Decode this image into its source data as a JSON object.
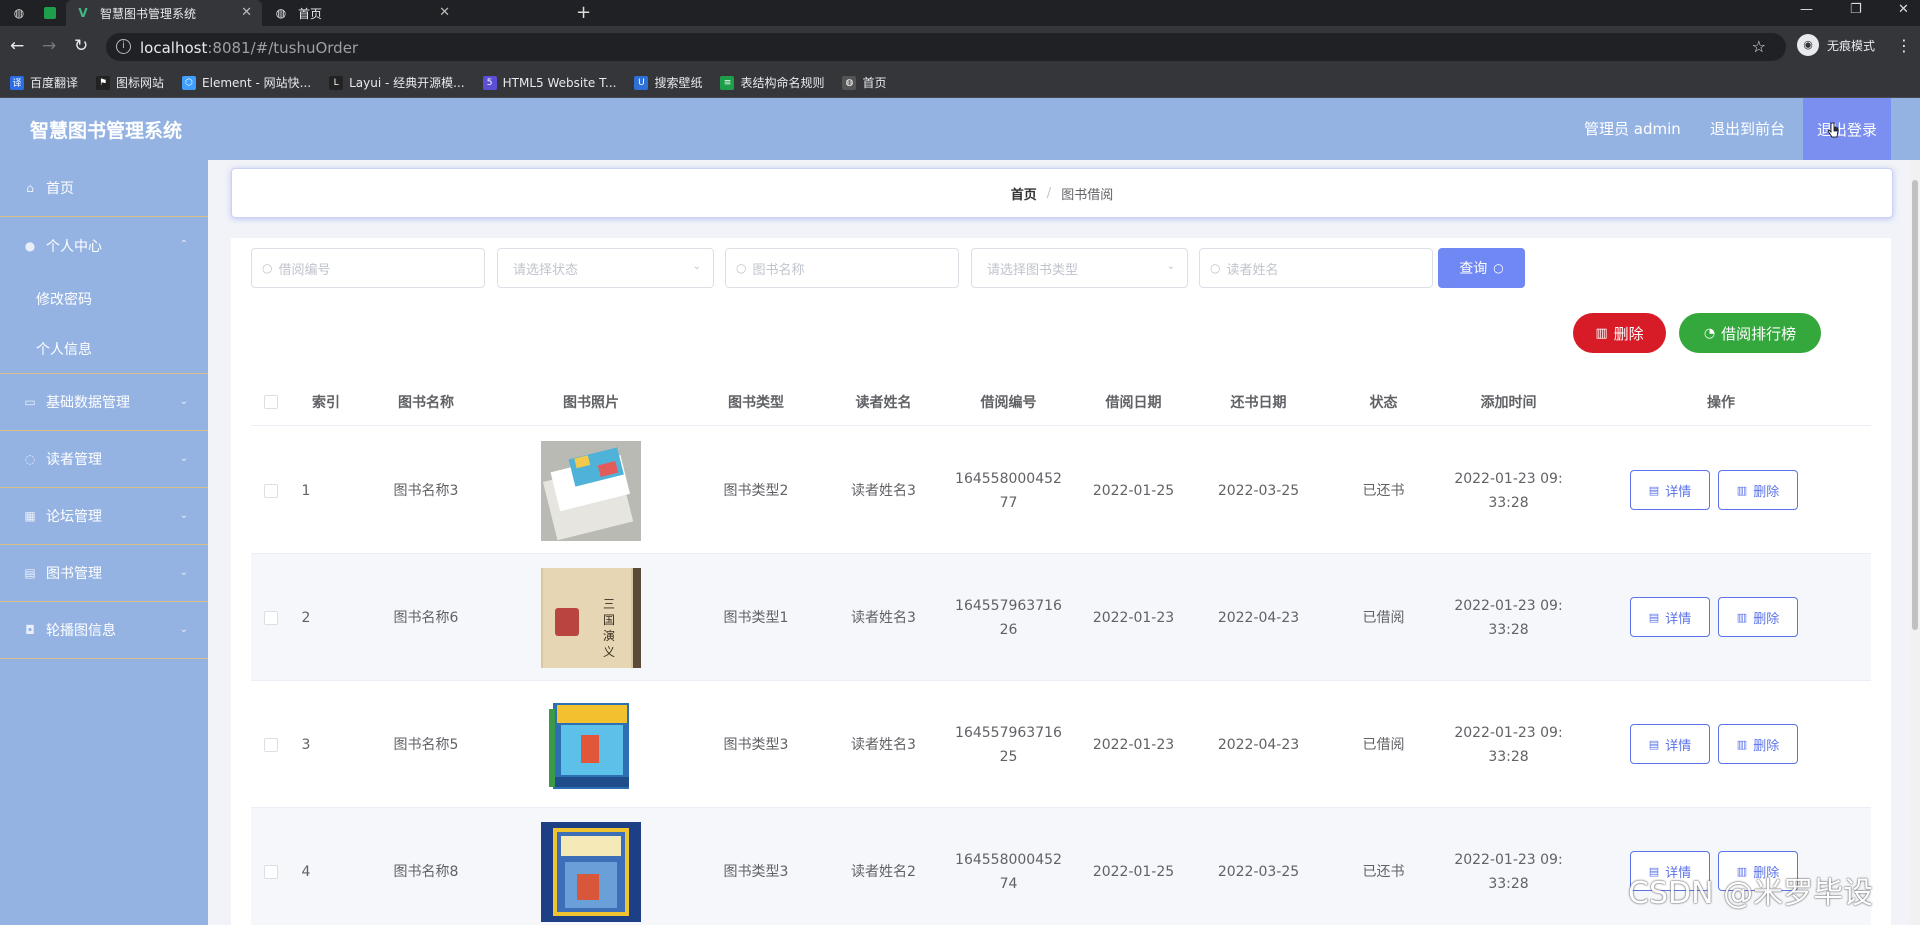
{
  "browser": {
    "tabs": [
      {
        "title": "智慧图书管理系统",
        "active": true
      },
      {
        "title": "首页",
        "active": false
      }
    ],
    "url_host": "localhost",
    "url_rest": ":8081/#/tushuOrder",
    "profile_label": "无痕模式",
    "bookmarks": [
      {
        "label": "百度翻译",
        "color": "#2b6de6"
      },
      {
        "label": "图标网站",
        "color": "#222222"
      },
      {
        "label": "Element - 网站快...",
        "color": "#409eff"
      },
      {
        "label": "Layui - 经典开源模...",
        "color": "#222222"
      },
      {
        "label": "HTML5 Website T...",
        "color": "#5b4fd6"
      },
      {
        "label": "搜索壁纸",
        "color": "#2f6fd8"
      },
      {
        "label": "表结构命名规则",
        "color": "#1e9e4a"
      },
      {
        "label": "首页",
        "color": "#555555"
      }
    ]
  },
  "header": {
    "title": "智慧图书管理系统",
    "admin_label": "管理员 admin",
    "to_front_label": "退出到前台",
    "logout_label": "退出登录",
    "bg_color": "#94b3e3"
  },
  "sidebar": {
    "home": "首页",
    "personal_center": "个人中心",
    "change_password": "修改密码",
    "personal_info": "个人信息",
    "basic_data": "基础数据管理",
    "reader_mgmt": "读者管理",
    "forum_mgmt": "论坛管理",
    "book_mgmt": "图书管理",
    "carousel_info": "轮播图信息"
  },
  "breadcrumb": {
    "home": "首页",
    "separator": "/",
    "current": "图书借阅"
  },
  "search": {
    "borrow_no_placeholder": "借阅编号",
    "status_placeholder": "请选择状态",
    "book_name_placeholder": "图书名称",
    "book_type_placeholder": "请选择图书类型",
    "reader_name_placeholder": "读者姓名",
    "query_label": "查询"
  },
  "actions": {
    "delete_label": "删除",
    "ranking_label": "借阅排行榜"
  },
  "table": {
    "headers": {
      "index": "索引",
      "book_name": "图书名称",
      "book_photo": "图书照片",
      "book_type": "图书类型",
      "reader_name": "读者姓名",
      "borrow_no": "借阅编号",
      "borrow_date": "借阅日期",
      "return_date": "还书日期",
      "status": "状态",
      "add_time": "添加时间",
      "operation": "操作"
    },
    "detail_label": "详情",
    "delete_label": "删除",
    "rows": [
      {
        "index": "1",
        "book_name": "图书名称3",
        "book_type": "图书类型2",
        "reader_name": "读者姓名3",
        "borrow_no": "164558000452 77",
        "borrow_date": "2022-01-25",
        "return_date": "2022-03-25",
        "status": "已还书",
        "add_time": "2022-01-23 09: 33:28"
      },
      {
        "index": "2",
        "book_name": "图书名称6",
        "book_type": "图书类型1",
        "reader_name": "读者姓名3",
        "borrow_no": "164557963716 26",
        "borrow_date": "2022-01-23",
        "return_date": "2022-04-23",
        "status": "已借阅",
        "add_time": "2022-01-23 09: 33:28"
      },
      {
        "index": "3",
        "book_name": "图书名称5",
        "book_type": "图书类型3",
        "reader_name": "读者姓名3",
        "borrow_no": "164557963716 25",
        "borrow_date": "2022-01-23",
        "return_date": "2022-04-23",
        "status": "已借阅",
        "add_time": "2022-01-23 09: 33:28"
      },
      {
        "index": "4",
        "book_name": "图书名称8",
        "book_type": "图书类型3",
        "reader_name": "读者姓名2",
        "borrow_no": "164558000452 74",
        "borrow_date": "2022-01-25",
        "return_date": "2022-03-25",
        "status": "已还书",
        "add_time": "2022-01-23 09: 33:28"
      }
    ]
  },
  "watermark": "CSDN @米罗毕设",
  "colors": {
    "accent": "#6f88f3",
    "danger": "#d71b27",
    "success": "#34a83c",
    "sidebar": "#94b3e3"
  }
}
